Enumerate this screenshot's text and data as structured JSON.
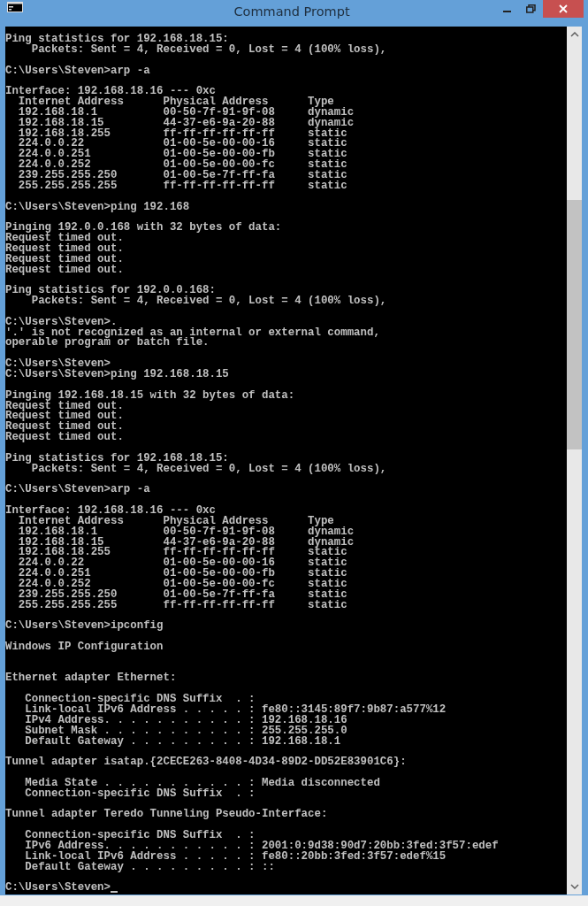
{
  "window": {
    "title": "Command Prompt"
  },
  "console": {
    "cursor_visible": true,
    "blocks": [
      {
        "lines": [
          "Ping statistics for 192.168.18.15:",
          "    Packets: Sent = 4, Received = 0, Lost = 4 (100% loss),"
        ]
      },
      {
        "lines": [
          "C:\\Users\\Steven>arp -a"
        ]
      },
      {
        "lines": [
          "Interface: 192.168.18.16 --- 0xc",
          "  Internet Address      Physical Address      Type",
          "  192.168.18.1          00-50-7f-91-9f-08     dynamic",
          "  192.168.18.15         44-37-e6-9a-20-88     dynamic",
          "  192.168.18.255        ff-ff-ff-ff-ff-ff     static",
          "  224.0.0.22            01-00-5e-00-00-16     static",
          "  224.0.0.251           01-00-5e-00-00-fb     static",
          "  224.0.0.252           01-00-5e-00-00-fc     static",
          "  239.255.255.250       01-00-5e-7f-ff-fa     static",
          "  255.255.255.255       ff-ff-ff-ff-ff-ff     static"
        ]
      },
      {
        "lines": [
          "C:\\Users\\Steven>ping 192.168"
        ]
      },
      {
        "lines": [
          "Pinging 192.0.0.168 with 32 bytes of data:",
          "Request timed out.",
          "Request timed out.",
          "Request timed out.",
          "Request timed out."
        ]
      },
      {
        "lines": [
          "Ping statistics for 192.0.0.168:",
          "    Packets: Sent = 4, Received = 0, Lost = 4 (100% loss),"
        ]
      },
      {
        "lines": [
          "C:\\Users\\Steven>.",
          "'.' is not recognized as an internal or external command,",
          "operable program or batch file."
        ]
      },
      {
        "lines": [
          "C:\\Users\\Steven>",
          "C:\\Users\\Steven>ping 192.168.18.15"
        ]
      },
      {
        "lines": [
          "Pinging 192.168.18.15 with 32 bytes of data:",
          "Request timed out.",
          "Request timed out.",
          "Request timed out.",
          "Request timed out."
        ]
      },
      {
        "lines": [
          "Ping statistics for 192.168.18.15:",
          "    Packets: Sent = 4, Received = 0, Lost = 4 (100% loss),"
        ]
      },
      {
        "lines": [
          "C:\\Users\\Steven>arp -a"
        ]
      },
      {
        "lines": [
          "Interface: 192.168.18.16 --- 0xc",
          "  Internet Address      Physical Address      Type",
          "  192.168.18.1          00-50-7f-91-9f-08     dynamic",
          "  192.168.18.15         44-37-e6-9a-20-88     dynamic",
          "  192.168.18.255        ff-ff-ff-ff-ff-ff     static",
          "  224.0.0.22            01-00-5e-00-00-16     static",
          "  224.0.0.251           01-00-5e-00-00-fb     static",
          "  224.0.0.252           01-00-5e-00-00-fc     static",
          "  239.255.255.250       01-00-5e-7f-ff-fa     static",
          "  255.255.255.255       ff-ff-ff-ff-ff-ff     static"
        ]
      },
      {
        "lines": [
          "C:\\Users\\Steven>ipconfig"
        ]
      },
      {
        "lines": [
          "Windows IP Configuration"
        ]
      },
      {
        "extra_space_before": true,
        "lines": [
          "Ethernet adapter Ethernet:"
        ]
      },
      {
        "lines": [
          "   Connection-specific DNS Suffix  . :",
          "   Link-local IPv6 Address . . . . . : fe80::3145:89f7:9b87:a577%12",
          "   IPv4 Address. . . . . . . . . . . : 192.168.18.16",
          "   Subnet Mask . . . . . . . . . . . : 255.255.255.0",
          "   Default Gateway . . . . . . . . . : 192.168.18.1"
        ]
      },
      {
        "lines": [
          "Tunnel adapter isatap.{2CECE263-8408-4D34-89D2-DD52E83901C6}:"
        ]
      },
      {
        "lines": [
          "   Media State . . . . . . . . . . . : Media disconnected",
          "   Connection-specific DNS Suffix  . :"
        ]
      },
      {
        "lines": [
          "Tunnel adapter Teredo Tunneling Pseudo-Interface:"
        ]
      },
      {
        "lines": [
          "   Connection-specific DNS Suffix  . :",
          "   IPv6 Address. . . . . . . . . . . : 2001:0:9d38:90d7:20bb:3fed:3f57:edef",
          "   Link-local IPv6 Address . . . . . : fe80::20bb:3fed:3f57:edef%15",
          "   Default Gateway . . . . . . . . . : ::"
        ]
      },
      {
        "lines": [
          "C:\\Users\\Steven>"
        ]
      }
    ]
  }
}
